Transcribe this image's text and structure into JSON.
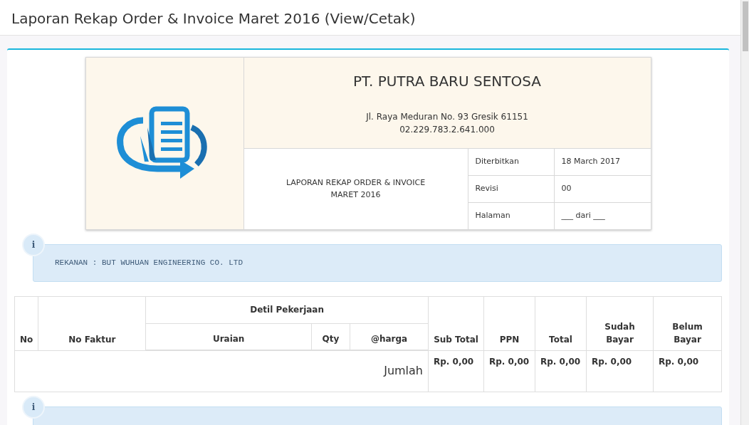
{
  "page_title": "Laporan Rekap Order & Invoice Maret 2016 (View/Cetak)",
  "report_header": {
    "company": "PT. PUTRA BARU SENTOSA",
    "address": "Jl. Raya Meduran No. 93 Gresik 61151",
    "tax_id": "02.229.783.2.641.000",
    "report_title_lines": [
      "LAPORAN REKAP ORDER & INVOICE",
      "MARET 2016"
    ],
    "meta": [
      {
        "label": "Diterbitkan",
        "value": "18 March 2017"
      },
      {
        "label": "Revisi",
        "value": "00"
      },
      {
        "label": "Halaman",
        "value": "___ dari ___"
      }
    ]
  },
  "partners": [
    {
      "icon": "i",
      "text": "REKANAN : BUT WUHUAN ENGINEERING CO. LTD",
      "table": {
        "group_header": "Detil Pekerjaan",
        "columns_before": [
          "No",
          "No Faktur"
        ],
        "group_columns": [
          "Uraian",
          "Qty",
          "@harga"
        ],
        "columns_after": [
          "Sub Total",
          "PPN",
          "Total",
          "Sudah Bayar",
          "Belum Bayar"
        ],
        "total_row": {
          "label": "Jumlah",
          "values": [
            "Rp. 0,00",
            "Rp. 0,00",
            "Rp. 0,00",
            "Rp. 0,00",
            "Rp. 0,00"
          ]
        }
      }
    },
    {
      "icon": "i"
    }
  ]
}
